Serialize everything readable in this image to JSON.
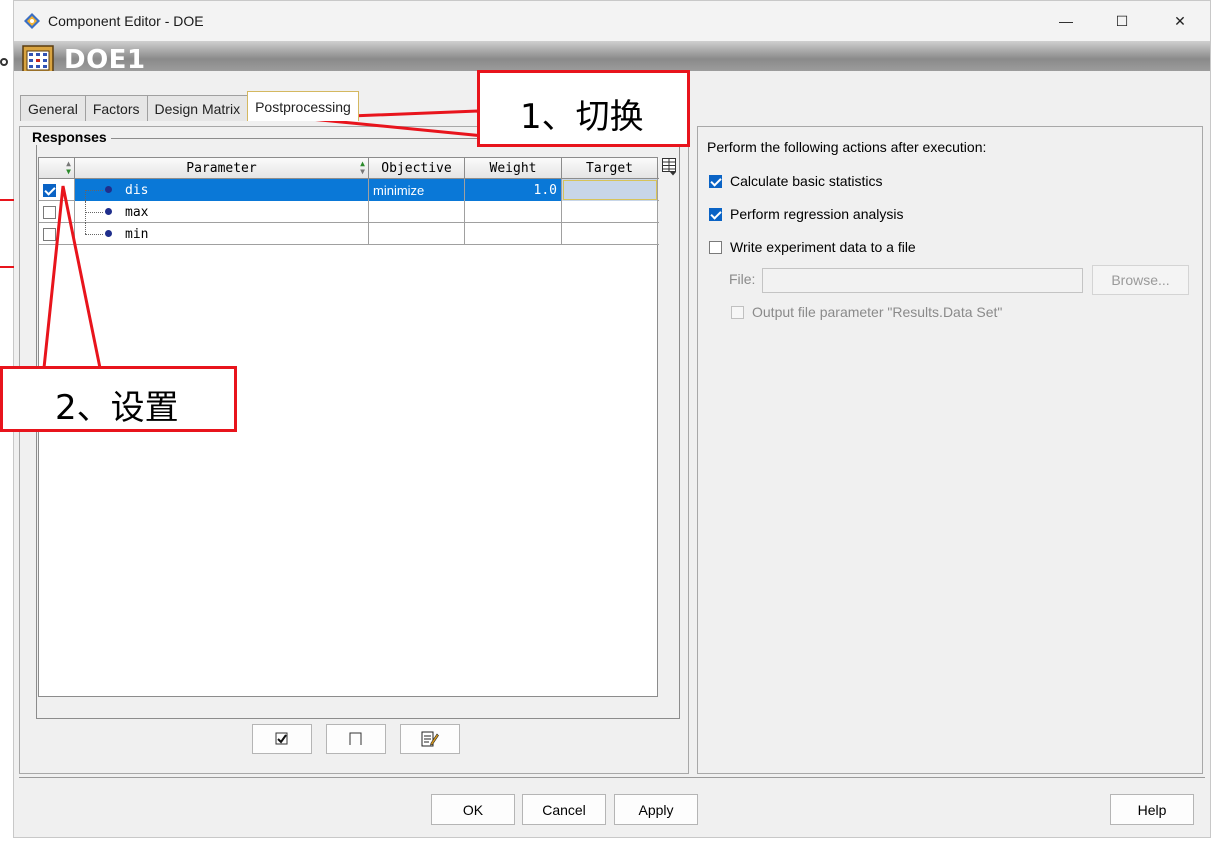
{
  "window": {
    "title": "Component Editor - DOE",
    "minimize_label": "—",
    "maximize_label": "☐",
    "close_label": "✕"
  },
  "header": {
    "component_name": "DOE1"
  },
  "tabs": [
    {
      "label": "General",
      "active": false
    },
    {
      "label": "Factors",
      "active": false
    },
    {
      "label": "Design Matrix",
      "active": false
    },
    {
      "label": "Postprocessing",
      "active": true
    }
  ],
  "responses": {
    "group_label": "Responses",
    "columns": [
      "",
      "Parameter",
      "Objective",
      "Weight",
      "Target"
    ],
    "rows": [
      {
        "checked": true,
        "parameter": "dis",
        "objective": "minimize",
        "weight": "1.0",
        "target": "",
        "selected": true
      },
      {
        "checked": false,
        "parameter": "max",
        "objective": "",
        "weight": "",
        "target": "",
        "selected": false
      },
      {
        "checked": false,
        "parameter": "min",
        "objective": "",
        "weight": "",
        "target": "",
        "selected": false
      }
    ]
  },
  "postprocessing": {
    "heading": "Perform the following actions after execution:",
    "calc_stats": {
      "label": "Calculate basic statistics",
      "checked": true
    },
    "regression": {
      "label": "Perform regression analysis",
      "checked": true
    },
    "write_data": {
      "label": "Write experiment data to a file",
      "checked": false
    },
    "file_label": "File:",
    "file_value": "",
    "browse_label": "Browse...",
    "output_param": {
      "label": "Output file parameter \"Results.Data Set\"",
      "checked": false
    }
  },
  "footer": {
    "ok_label": "OK",
    "cancel_label": "Cancel",
    "apply_label": "Apply",
    "help_label": "Help"
  },
  "annotations": {
    "step1": "1、切换",
    "step2": "2、设置"
  },
  "colors": {
    "selection": "#0a78d7",
    "annotation_red": "#e8141c",
    "active_tab_border": "#d4b860"
  }
}
